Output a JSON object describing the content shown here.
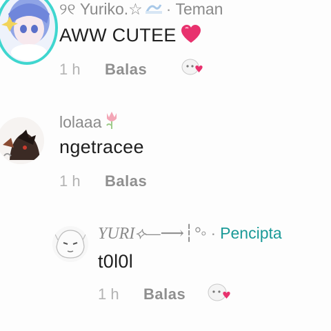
{
  "comments": [
    {
      "username": "୨୧ Yuriko.☆",
      "badge": "Teman",
      "text": "AWW CUTEE",
      "time": "1 h",
      "reply_label": "Balas"
    },
    {
      "username": "lolaaa",
      "text": "ngetracee",
      "time": "1 h",
      "reply_label": "Balas"
    },
    {
      "username": "YURI⟡—⟶┆°◦",
      "badge": "Pencipta",
      "text": "t0l0l",
      "time": "1 h",
      "reply_label": "Balas"
    }
  ],
  "icons": {
    "heart": "heart-emoji",
    "tulip": "tulip-icon",
    "wave": "wave-icon",
    "like": "like-sticker-icon"
  },
  "colors": {
    "creator_badge": "#1b9a98",
    "avatar_ring": "#3fd6cf",
    "heart": "#e8326e"
  }
}
